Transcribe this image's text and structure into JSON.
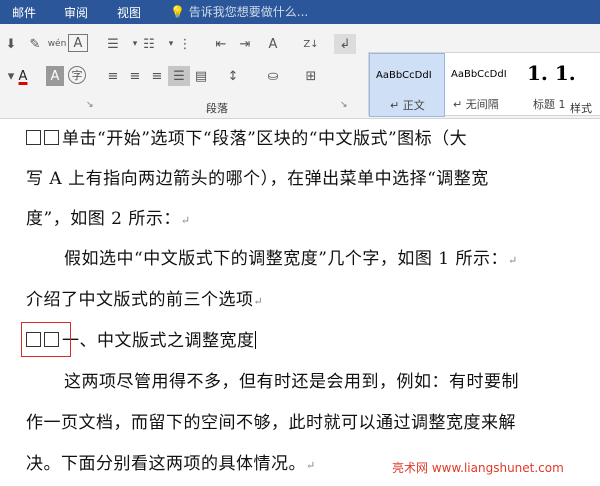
{
  "tabs": [
    "邮件",
    "审阅",
    "视图"
  ],
  "tell_me": "告诉我您想要做什么...",
  "ribbon": {
    "group_paragraph": "段落",
    "group_styles": "样式",
    "styles": [
      {
        "sample": "AaBbCcDdI",
        "name": "↵ 正文"
      },
      {
        "sample": "AaBbCcDdI",
        "name": "↵ 无间隔"
      },
      {
        "sample": "1. 1.",
        "name": "标题 1"
      }
    ]
  },
  "doc": {
    "lines": [
      "单击“开始”选项下“段落”区块的“中文版式”图标（大",
      "写 A 上有指向两边箭头的哪个），在弹出菜单中选择“调整宽",
      "度”，如图 2 所示：",
      "假如选中“中文版式下的调整宽度”几个字，如图 1 所示：",
      "介绍了中文版式的前三个选项",
      "一、中文版式之调整宽度",
      "这两项尽管用得不多，但有时还是会用到，例如：有时要制",
      "作一页文档，而留下的空间不够，此时就可以通过调整宽度来解",
      "决。下面分别看这两项的具体情况。"
    ],
    "return_mark": "↵"
  },
  "watermark": "亮术网 www.liangshunet.com"
}
